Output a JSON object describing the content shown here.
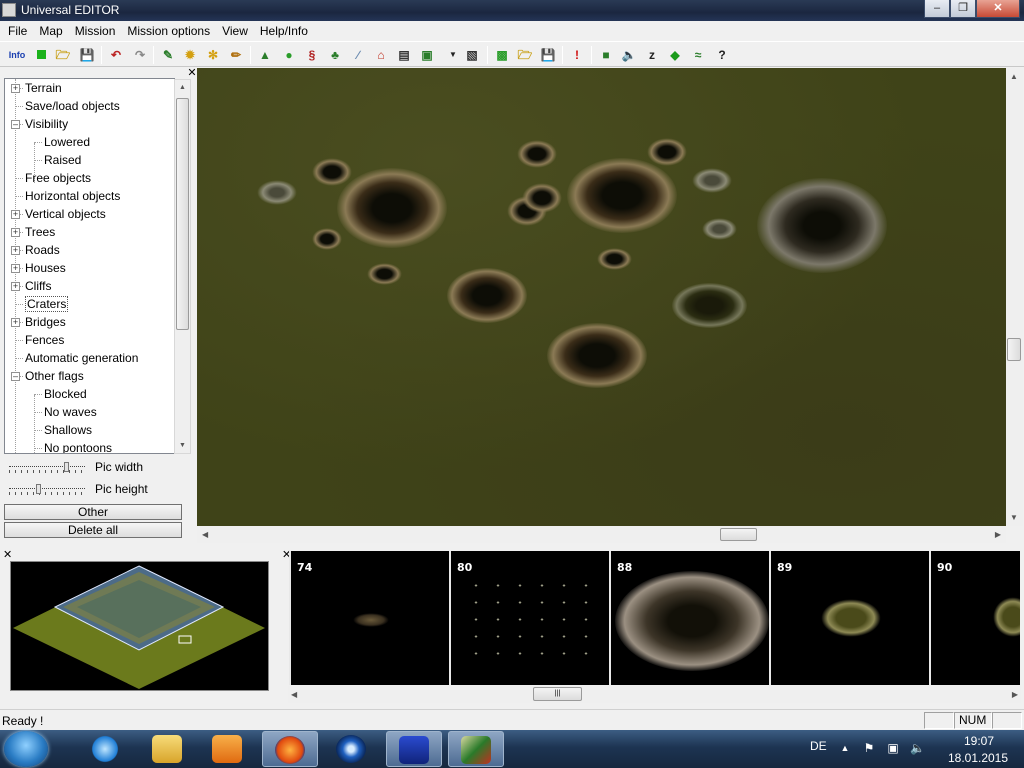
{
  "window": {
    "title": "Universal EDITOR"
  },
  "menu": [
    "File",
    "Map",
    "Mission",
    "Mission options",
    "View",
    "Help/Info"
  ],
  "toolbar": {
    "info_label": "Info"
  },
  "tree": {
    "items": [
      {
        "label": "Terrain",
        "level": 0,
        "expander": "+"
      },
      {
        "label": "Save/load objects",
        "level": 0,
        "expander": ""
      },
      {
        "label": "Visibility",
        "level": 0,
        "expander": "-"
      },
      {
        "label": "Lowered",
        "level": 1,
        "expander": ""
      },
      {
        "label": "Raised",
        "level": 1,
        "expander": ""
      },
      {
        "label": "Free objects",
        "level": 0,
        "expander": ""
      },
      {
        "label": "Horizontal objects",
        "level": 0,
        "expander": ""
      },
      {
        "label": "Vertical objects",
        "level": 0,
        "expander": "+"
      },
      {
        "label": "Trees",
        "level": 0,
        "expander": "+"
      },
      {
        "label": "Roads",
        "level": 0,
        "expander": "+"
      },
      {
        "label": "Houses",
        "level": 0,
        "expander": "+"
      },
      {
        "label": "Cliffs",
        "level": 0,
        "expander": "+"
      },
      {
        "label": "Craters",
        "level": 0,
        "expander": "",
        "selected": true
      },
      {
        "label": "Bridges",
        "level": 0,
        "expander": "+"
      },
      {
        "label": "Fences",
        "level": 0,
        "expander": ""
      },
      {
        "label": "Automatic generation",
        "level": 0,
        "expander": ""
      },
      {
        "label": "Other flags",
        "level": 0,
        "expander": "-"
      },
      {
        "label": "Blocked",
        "level": 1,
        "expander": ""
      },
      {
        "label": "No waves",
        "level": 1,
        "expander": ""
      },
      {
        "label": "Shallows",
        "level": 1,
        "expander": ""
      },
      {
        "label": "No pontoons",
        "level": 1,
        "expander": ""
      }
    ]
  },
  "controls": {
    "pic_width_label": "Pic width",
    "pic_height_label": "Pic height",
    "pic_width_value": 0.78,
    "pic_height_value": 0.38,
    "other_button": "Other",
    "delete_all_button": "Delete all"
  },
  "pictures": {
    "items": [
      {
        "number": "74"
      },
      {
        "number": "80"
      },
      {
        "number": "88"
      },
      {
        "number": "89"
      },
      {
        "number": "90"
      }
    ]
  },
  "status": {
    "text": "Ready !",
    "num_indicator": "NUM"
  },
  "taskbar": {
    "language": "DE",
    "time": "19:07",
    "date": "18.01.2015"
  }
}
